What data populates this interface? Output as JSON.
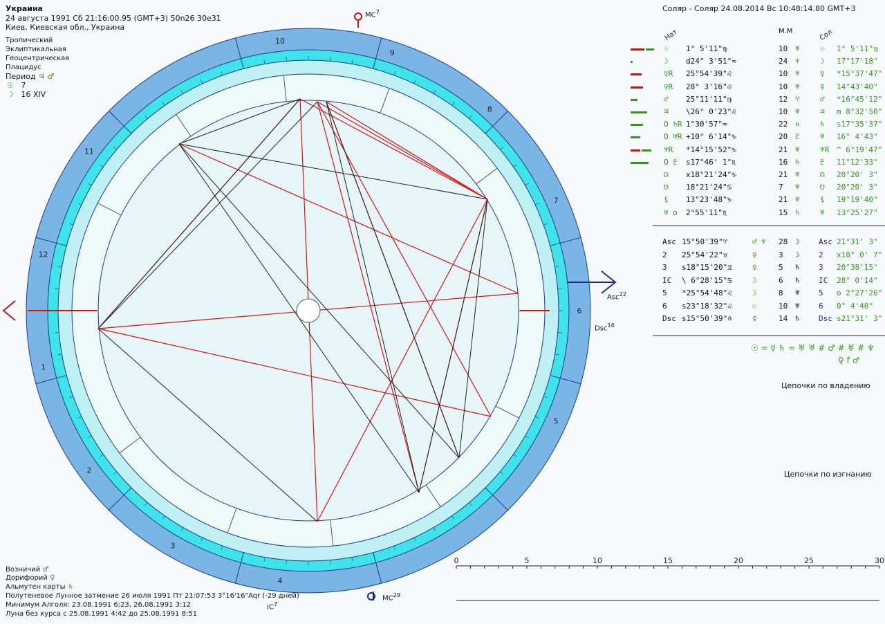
{
  "header": {
    "title": "Украина",
    "date_line": "24 августа 1991  Сб  21:16:00.95 (GMT+3) 50n26  30e31",
    "place_line": "Киев, Киевская обл., Украина"
  },
  "settings": [
    "Тропический",
    "Эклиптикальная",
    "Геоцентрическая",
    "Плацидус"
  ],
  "period": {
    "label": "Период",
    "glyphs": "♃ ♂",
    "sun": "☉",
    "sun_val": "7",
    "moon": "☽",
    "moon_val": "16 XIV"
  },
  "solar": {
    "title": "Соляр - Соляр 24.08.2014  Вс 10:48:14.80 GMT+3"
  },
  "col_headers": {
    "nat": "Нат",
    "mm": "М.М",
    "sol": "Сол"
  },
  "planets": [
    {
      "g": "☉",
      "pos": " 1° 5'11\"♍",
      "mm": "10",
      "mmg": "♅",
      "sg": "☉",
      "spos": " 1° 5'11\"♍",
      "bars": [
        [
          "#d01010",
          20
        ],
        [
          "#2f9a12",
          12
        ]
      ]
    },
    {
      "g": "☽",
      "pos": "d24° 3'51\"≈",
      "mm": "24",
      "mmg": "♆",
      "sg": "☽",
      "spos": "17°17'18\"",
      "bars": [
        [
          "#2f9a12",
          3
        ]
      ]
    },
    {
      "g": "☿R",
      "pos": "25°54'39\"♌",
      "mm": "10",
      "mmg": "♅",
      "sg": "☿",
      "spos": "*15°37'47\"",
      "bars": [
        [
          "#d01010",
          16
        ]
      ]
    },
    {
      "g": "♀R",
      "pos": "28° 3'16\"♌",
      "mm": "10",
      "mmg": "♅",
      "sg": "♀",
      "spos": "14°43'40\"",
      "bars": [
        [
          "#d01010",
          18
        ]
      ]
    },
    {
      "g": "♂",
      "pos": "25°11'11\"♍",
      "mm": "12",
      "mmg": "♈",
      "sg": "♂",
      "spos": "*16°45'12\"",
      "bars": [
        [
          "#2f9a12",
          10
        ]
      ]
    },
    {
      "g": "♃",
      "pos": "\\26° 0'23\"♌",
      "mm": "10",
      "mmg": "♅",
      "sg": "♃",
      "spos": "m 8°32'50\"",
      "bars": [
        [
          "#2f9a12",
          24
        ]
      ]
    },
    {
      "g": "O ♄R",
      "pos": "1°30'57\"≈",
      "mm": "22",
      "mmg": "♓",
      "sg": "♄",
      "spos": "s17°35'37\"",
      "bars": [
        [
          "#2f9a12",
          18
        ]
      ]
    },
    {
      "g": "O ♅R",
      "pos": "+10° 6'14\"♑",
      "mm": "20",
      "mmg": "♇",
      "sg": "♅",
      "spos": "16° 4'43\"",
      "bars": [
        [
          "#2f9a12",
          14
        ]
      ]
    },
    {
      "g": "♆R",
      "pos": "*14°15'52\"♑",
      "mm": "21",
      "mmg": "♅",
      "sg": "♆R",
      "spos": "^ 6°19'47\"",
      "bars": [
        [
          "#d01010",
          14
        ],
        [
          "#2f9a12",
          14
        ]
      ]
    },
    {
      "g": "O ♇",
      "pos": "s17°46' 1\"♏",
      "mm": "16",
      "mmg": "♄",
      "sg": "♇",
      "spos": "11°12'33\"",
      "bars": [
        [
          "#2f9a12",
          26
        ]
      ]
    },
    {
      "g": "☊",
      "pos": "x18°21'24\"♑",
      "mm": "21",
      "mmg": "♅",
      "sg": "☊",
      "spos": "20°20' 3\"",
      "bars": []
    },
    {
      "g": "☋",
      "pos": "18°21'24\"♋",
      "mm": "7",
      "mmg": "♅",
      "sg": "☋",
      "spos": "20°20' 3\"",
      "bars": []
    },
    {
      "g": "⚸",
      "pos": "13°23'48\"♑",
      "mm": "21",
      "mmg": "♅",
      "sg": "⚸",
      "spos": "19°19'40\"",
      "bars": []
    },
    {
      "g": "♅ o",
      "pos": "2°55'11\"♏",
      "mm": "15",
      "mmg": "♄",
      "sg": "♅",
      "spos": "13°25'27\"",
      "bars": []
    }
  ],
  "houses": [
    {
      "g": "Asc",
      "pos": "15°50'39\"♈",
      "ruler": "♂ ♆",
      "mm": "28",
      "mmg": "☽",
      "sg": "Asc",
      "spos": "21°31' 3\""
    },
    {
      "g": "2",
      "pos": "25°54'22\"♉",
      "ruler": "♀",
      "mm": "3",
      "mmg": "☽",
      "sg": "2",
      "spos": "x18° 0' 7\""
    },
    {
      "g": "3",
      "pos": "s18°15'20\"♊",
      "ruler": "♀",
      "mm": "5",
      "mmg": "♄",
      "sg": "3",
      "spos": "20°38'15\""
    },
    {
      "g": "IC",
      "pos": "\\ 6°28'15\"♋",
      "ruler": "☽",
      "mm": "6",
      "mmg": "♄",
      "sg": "IC",
      "spos": "28° 0'14\""
    },
    {
      "g": "5",
      "pos": "*25°54'48\"♌",
      "ruler": "☽",
      "mm": "8",
      "mmg": "♅",
      "sg": "5",
      "spos": "o 2°27'26\""
    },
    {
      "g": "6",
      "pos": "s23°18'32\"♌",
      "ruler": "☉",
      "mm": "10",
      "mmg": "♅",
      "sg": "6",
      "spos": "0° 4'40\""
    },
    {
      "g": "Dsc",
      "pos": "s15°50'39\"♎",
      "ruler": "♀",
      "mm": "14",
      "mmg": "♄",
      "sg": "Dsc",
      "spos": "s21°31' 3\""
    }
  ],
  "formula": {
    "line1": "☉ = ☿ ♄ = ♅ ♅ # ♂ # ♅ # ♆",
    "line2": "♀ f ♂"
  },
  "chains": {
    "ownership": "Цепочки по владению",
    "exile": "Цепочки по изгнанию"
  },
  "footer": [
    {
      "label": "Возничий",
      "glyph": "♂"
    },
    {
      "label": "Дорифорий",
      "glyph": "♀"
    },
    {
      "label": "Альмутен карты",
      "glyph": "♄"
    }
  ],
  "footer_lines": [
    "Полутеневое Лунное затмение 26 июля 1991 Пт 21:07:53  3°16'16\"Aqr (-29 дней)",
    "Минимум Алголя: 23.08.1991  6:23,  26.08.1991  3:12",
    "Луна без курса с 25.08.1991  4:42 до 25.08.1991  8:51"
  ],
  "axis_labels": {
    "mc": "MC",
    "mc_sup": "7",
    "asc": "Asc",
    "asc_sup": "22",
    "dsc": "Dsc",
    "dsc_sup": "16",
    "ic": "IC",
    "ic_sup": "7",
    "mc2": "MC",
    "mc2_sup": "29"
  },
  "timeline": {
    "ticks": [
      "0",
      "5",
      "10",
      "15",
      "20",
      "25",
      "30"
    ]
  },
  "house_numbers": [
    "10",
    "9",
    "8",
    "7",
    "6",
    "5",
    "4",
    "3",
    "2",
    "1",
    "12",
    "11"
  ],
  "colors": {
    "outer_ring": "#7ab5e6",
    "inner_ring": "#3fe3ea",
    "center": "#e6f5f8",
    "aspect_red": "#dd1010",
    "aspect_black": "#222222",
    "accent_blue": "#1f2aa8"
  }
}
